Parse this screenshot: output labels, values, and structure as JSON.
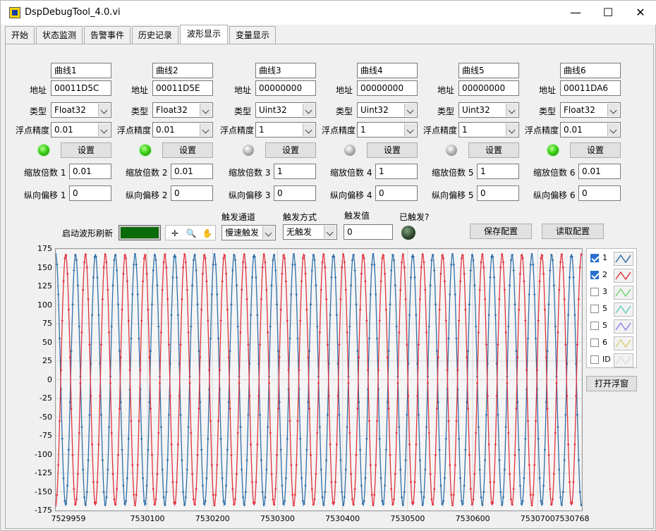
{
  "window": {
    "title": "DspDebugTool_4.0.vi",
    "minimize": "—",
    "maximize": "☐",
    "close": "✕"
  },
  "tabs": [
    {
      "label": "开始"
    },
    {
      "label": "状态监测"
    },
    {
      "label": "告警事件"
    },
    {
      "label": "历史记录"
    },
    {
      "label": "波形显示",
      "active": true
    },
    {
      "label": "变量显示"
    }
  ],
  "labels": {
    "address": "地址",
    "type": "类型",
    "precision": "浮点精度",
    "set_button": "设置"
  },
  "channels": [
    {
      "name": "曲线1",
      "address": "00011D5C",
      "type": "Float32",
      "precision": "0.01",
      "led": "on",
      "scale_label": "缩放倍数 1",
      "scale": "0.01",
      "offset_label": "纵向偏移 1",
      "offset": "0"
    },
    {
      "name": "曲线2",
      "address": "00011D5E",
      "type": "Float32",
      "precision": "0.01",
      "led": "on",
      "scale_label": "缩放倍数 2",
      "scale": "0.01",
      "offset_label": "纵向偏移 2",
      "offset": "0"
    },
    {
      "name": "曲线3",
      "address": "00000000",
      "type": "Uint32",
      "precision": "1",
      "led": "off",
      "scale_label": "缩放倍数 3",
      "scale": "1",
      "offset_label": "纵向偏移 3",
      "offset": "0"
    },
    {
      "name": "曲线4",
      "address": "00000000",
      "type": "Uint32",
      "precision": "1",
      "led": "off",
      "scale_label": "缩放倍数 4",
      "scale": "1",
      "offset_label": "纵向偏移 4",
      "offset": "0"
    },
    {
      "name": "曲线5",
      "address": "00000000",
      "type": "Uint32",
      "precision": "1",
      "led": "off",
      "scale_label": "缩放倍数 5",
      "scale": "1",
      "offset_label": "纵向偏移 5",
      "offset": "0"
    },
    {
      "name": "曲线6",
      "address": "00011DA6",
      "type": "Float32",
      "precision": "0.01",
      "led": "on",
      "scale_label": "缩放倍数 6",
      "scale": "0.01",
      "offset_label": "纵向偏移 6",
      "offset": "0"
    }
  ],
  "controls": {
    "start_refresh_label": "启动波形刷新",
    "trigger_channel_label": "触发通道",
    "trigger_channel_value": "慢速触发",
    "trigger_mode_label": "触发方式",
    "trigger_mode_value": "无触发",
    "trigger_value_label": "触发值",
    "trigger_value": "0",
    "triggered_label": "已触发?",
    "save_config": "保存配置",
    "load_config": "读取配置",
    "open_float": "打开浮窗"
  },
  "legend": [
    {
      "name": "1",
      "checked": true,
      "color": "#2f6fa8"
    },
    {
      "name": "2",
      "checked": true,
      "color": "#e0323c"
    },
    {
      "name": "3",
      "checked": false,
      "color": "#6fd36f"
    },
    {
      "name": "5",
      "checked": false,
      "color": "#66ccbb"
    },
    {
      "name": "5",
      "checked": false,
      "color": "#8f7fe0"
    },
    {
      "name": "6",
      "checked": false,
      "color": "#d8d070"
    },
    {
      "name": "ID",
      "checked": false,
      "color": "#dddddd"
    }
  ],
  "chart_data": {
    "type": "line",
    "xlim": [
      7529959,
      7530768
    ],
    "ylim": [
      -175,
      175
    ],
    "x_ticks": [
      7529959,
      7530100,
      7530200,
      7530300,
      7530400,
      7530500,
      7530600,
      7530700,
      7530768
    ],
    "y_ticks": [
      175,
      150,
      125,
      100,
      75,
      50,
      25,
      0,
      -25,
      -50,
      -75,
      -100,
      -125,
      -150,
      -175
    ],
    "grid": true,
    "series": [
      {
        "name": "1",
        "color": "#2f6fa8",
        "amplitude": 168,
        "period": 30.5,
        "phase_deg": 90
      },
      {
        "name": "2",
        "color": "#e0323c",
        "amplitude": 168,
        "period": 30.5,
        "phase_deg": -90
      }
    ]
  }
}
